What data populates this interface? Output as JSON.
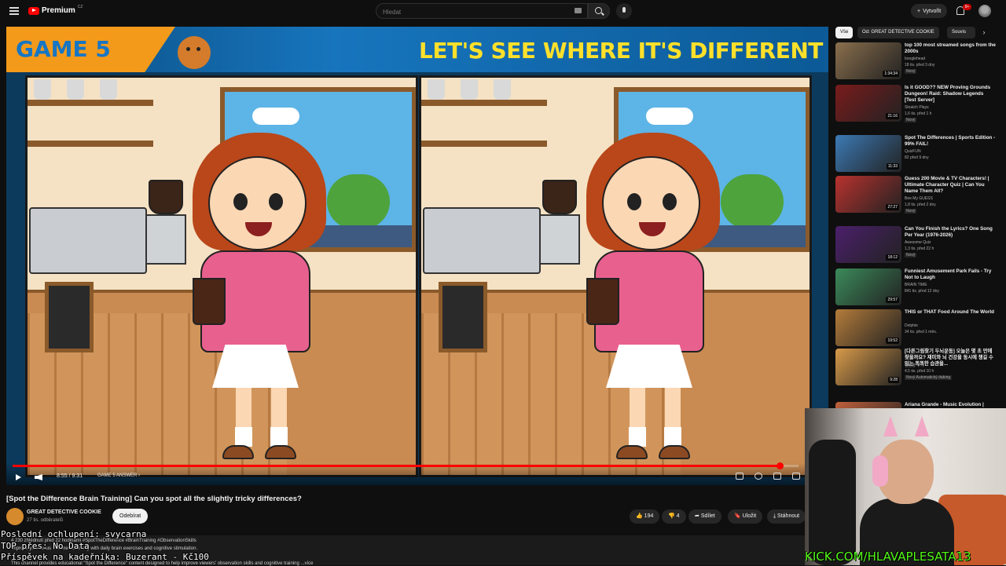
{
  "header": {
    "logo_text": "Premium",
    "logo_region": "CZ",
    "search_placeholder": "Hledat",
    "create_label": "Vytvořit",
    "notification_count": "9+"
  },
  "player": {
    "banner_left": "GAME 5",
    "banner_title": "LET'S SEE WHERE IT'S DIFFERENT",
    "time": "8:55 / 9:31",
    "chapter": "GAME 5 ANSWER ›",
    "progress": 0.976
  },
  "video": {
    "title": "[Spot the Difference Brain Training] Can you spot all the slightly tricky differences?",
    "channel_name": "GREAT DETECTIVE COOKIE",
    "channel_subs": "27 tis. odběratelů",
    "subscribe_label": "Odebírat",
    "likes": "194",
    "dislikes": "4",
    "share_label": "Sdílet",
    "save_label": "Uložit",
    "download_label": "Stáhnout",
    "desc_line1": "4 230 zhlédnutí  před 22 hodinami  #SpotTheDifference #BrainTraining #ObservationSkills",
    "desc_line2": "Improve your focus and mental clarity with daily brain exercises and cognitive stimulation.",
    "desc_line3": "This channel provides educational \"Spot the Difference\" content designed to help improve viewers' observation skills and cognitive training ...více"
  },
  "overlay": {
    "line1": "Poslední ochlupení: svycarna",
    "line2": "TOP přes: No Data",
    "line3": "Příspěvek na kadeřníka: Buzerant - Kč100",
    "kick": "KICK.COM/HLAVAPLESATA13"
  },
  "sidebar": {
    "chips": [
      "Vše",
      "Od: GREAT DETECTIVE COOKIE",
      "Souvis"
    ],
    "recommendations": [
      {
        "title": "top 100 most streamed songs from the 2000s",
        "channel": "booglehead",
        "meta": "18 tis.  před 3 dny",
        "badge": "Nový",
        "duration": "1:34:34",
        "thumb_color": "#8a6f4d"
      },
      {
        "title": "Is it GOOD?? NEW Proving Grounds Dungeon! Raid: Shadow Legends [Test Server]",
        "channel": "Skratch Plays",
        "meta": "1,6 tis.  před 1 h",
        "badge": "Nový",
        "duration": "21:16",
        "thumb_color": "#7a1b1b"
      },
      {
        "title": "Spot The Differences | Sports Edition - 99% FAIL!",
        "channel": "QuizFUN",
        "meta": "82  před 9 dny",
        "badge": "",
        "duration": "11:33",
        "thumb_color": "#3c7ab5"
      },
      {
        "title": "Guess 200 Movie & TV Characters! | Ultimate Character Quiz | Can You Name Them All?",
        "channel": "Bee My GUESS",
        "meta": "1,8 tis.  před 2 dny",
        "badge": "Nový",
        "duration": "27:27",
        "thumb_color": "#b8322e"
      },
      {
        "title": "Can You Finish the Lyrics? One Song Per Year (1976-2026)",
        "channel": "Awesome Quiz",
        "meta": "1,3 tis.  před 22 h",
        "badge": "Nový",
        "duration": "18:12",
        "thumb_color": "#4b1f6b"
      },
      {
        "title": "Funniest Amusement Park Fails - Try Not to Laugh",
        "channel": "BRAIN TIME",
        "meta": "841 tis.  před 12 dny",
        "badge": "",
        "duration": "29:57",
        "thumb_color": "#3b8a5a"
      },
      {
        "title": "THIS or THAT Food Around The World",
        "channel": "Delphie",
        "meta": "34 tis.  před 1 měs.",
        "badge": "",
        "duration": "19:52",
        "thumb_color": "#b47c3a"
      },
      {
        "title": "[다른그림찾기 두뇌운동] 오늘은 몇 초 만에 찾을까요? 재미와 뇌 건강을 동시에 챙길 수 있는 똑똑한 습관을...",
        "channel": "명탐정 쿠키",
        "meta": "4,5 tis.  před 10 h",
        "badge": "Nový  Automatický dabing",
        "duration": "9:28",
        "thumb_color": "#d89a4a"
      },
      {
        "title": "Ariana Grande - Music Evolution |",
        "channel": "",
        "meta": "",
        "badge": "",
        "duration": "",
        "thumb_color": "#c0603b"
      }
    ]
  },
  "colors": {
    "yt_red": "#ff0000",
    "banner_yellow": "#ffe02a",
    "kick_green": "#53fc18"
  }
}
